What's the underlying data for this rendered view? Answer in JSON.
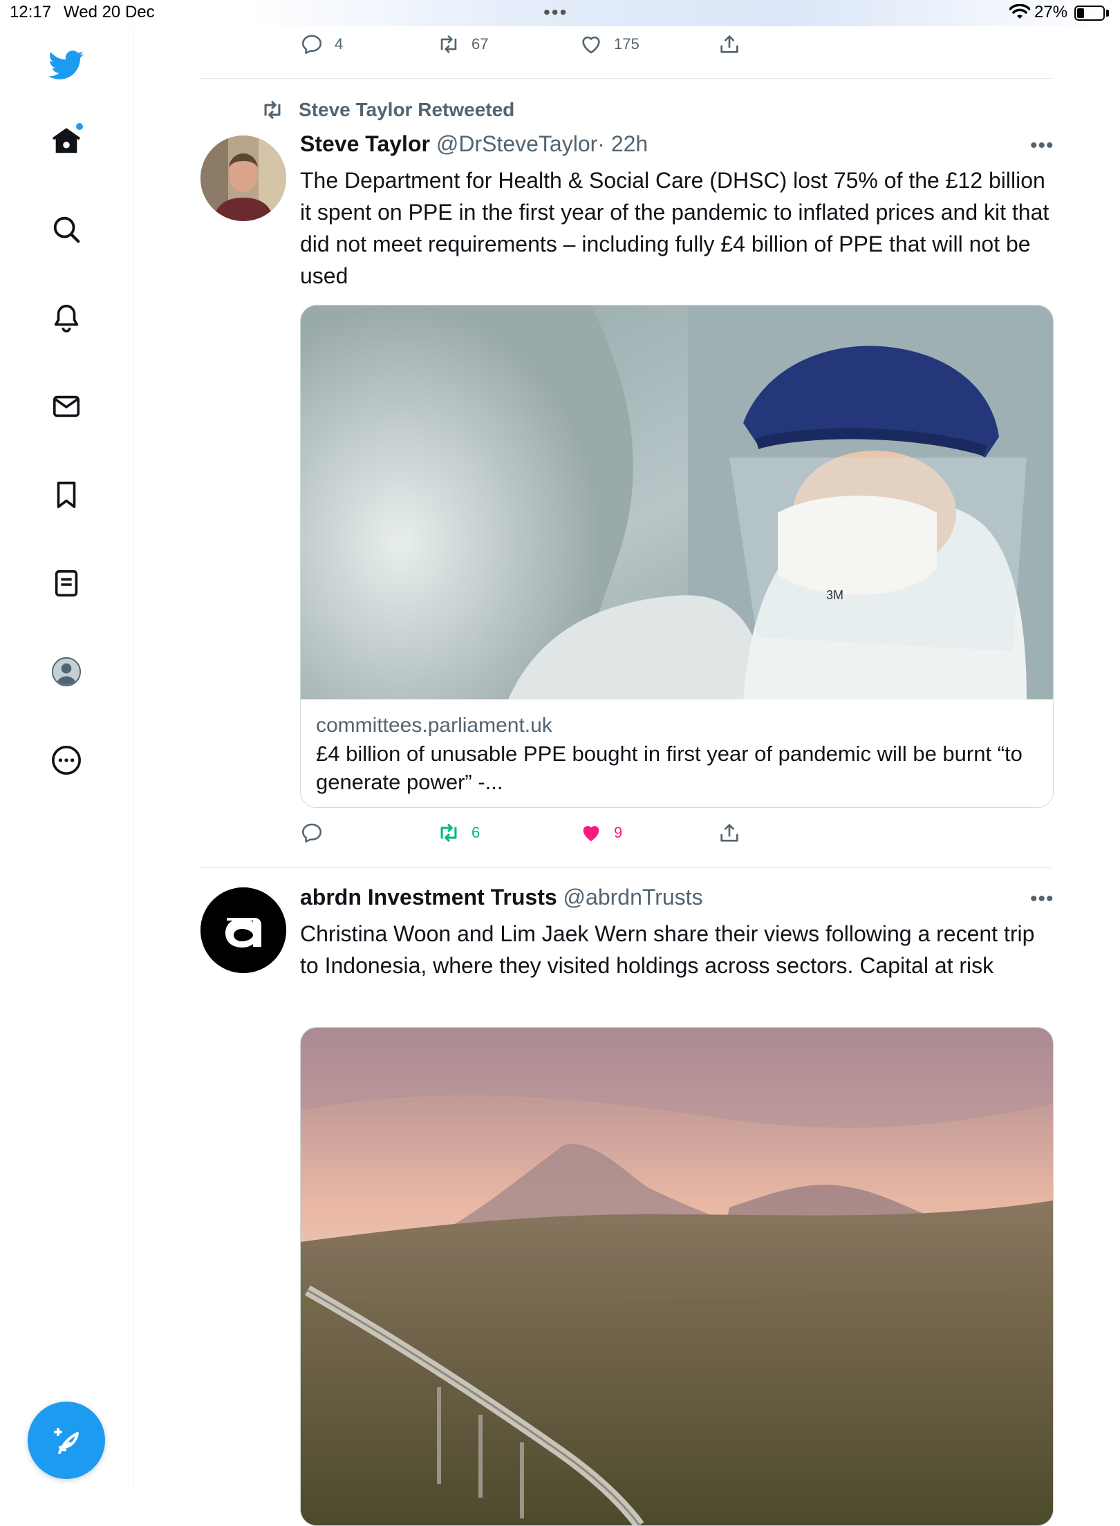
{
  "status_bar": {
    "time": "12:17",
    "date": "Wed 20 Dec",
    "battery": "27%",
    "battery_level": 0.27
  },
  "sidebar": {
    "items": [
      {
        "name": "home",
        "icon": "home-icon",
        "has_dot": true
      },
      {
        "name": "explore",
        "icon": "search-icon"
      },
      {
        "name": "notifications",
        "icon": "bell-icon"
      },
      {
        "name": "messages",
        "icon": "envelope-icon"
      },
      {
        "name": "bookmarks",
        "icon": "bookmark-icon"
      },
      {
        "name": "lists",
        "icon": "list-icon"
      },
      {
        "name": "profile",
        "icon": "profile-icon"
      },
      {
        "name": "more",
        "icon": "more-circle-icon"
      }
    ],
    "compose_icon": "compose-feather-icon",
    "accent": "#1d9bf0"
  },
  "top_tweet_actions": {
    "replies": "4",
    "retweets": "67",
    "likes": "175"
  },
  "tweet1": {
    "retweeted_by": "Steve Taylor Retweeted",
    "name": "Steve Taylor",
    "handle": "@DrSteveTaylor",
    "time": "· 22h",
    "text": "The Department for Health & Social Care (DHSC) lost 75% of the £12 billion it spent on PPE in the first year of the pandemic to inflated prices and kit that did not meet requirements – including fully £4 billion of PPE that will not be used",
    "card": {
      "domain": "committees.parliament.uk",
      "title": "£4 billion of unusable PPE bought in first year of pandemic will be burnt “to generate power” -..."
    },
    "actions": {
      "replies": "",
      "retweets": "6",
      "likes": "9",
      "retweeted": true,
      "liked": true
    }
  },
  "tweet2": {
    "name": "abrdn Investment Trusts",
    "handle": "@abrdnTrusts",
    "text": "Christina Woon and Lim Jaek Wern share their views following a recent trip to Indonesia, where they visited holdings across sectors. Capital at risk"
  },
  "colors": {
    "retweet_green": "#00ba7c",
    "like_pink": "#f91880",
    "muted": "#536471"
  }
}
